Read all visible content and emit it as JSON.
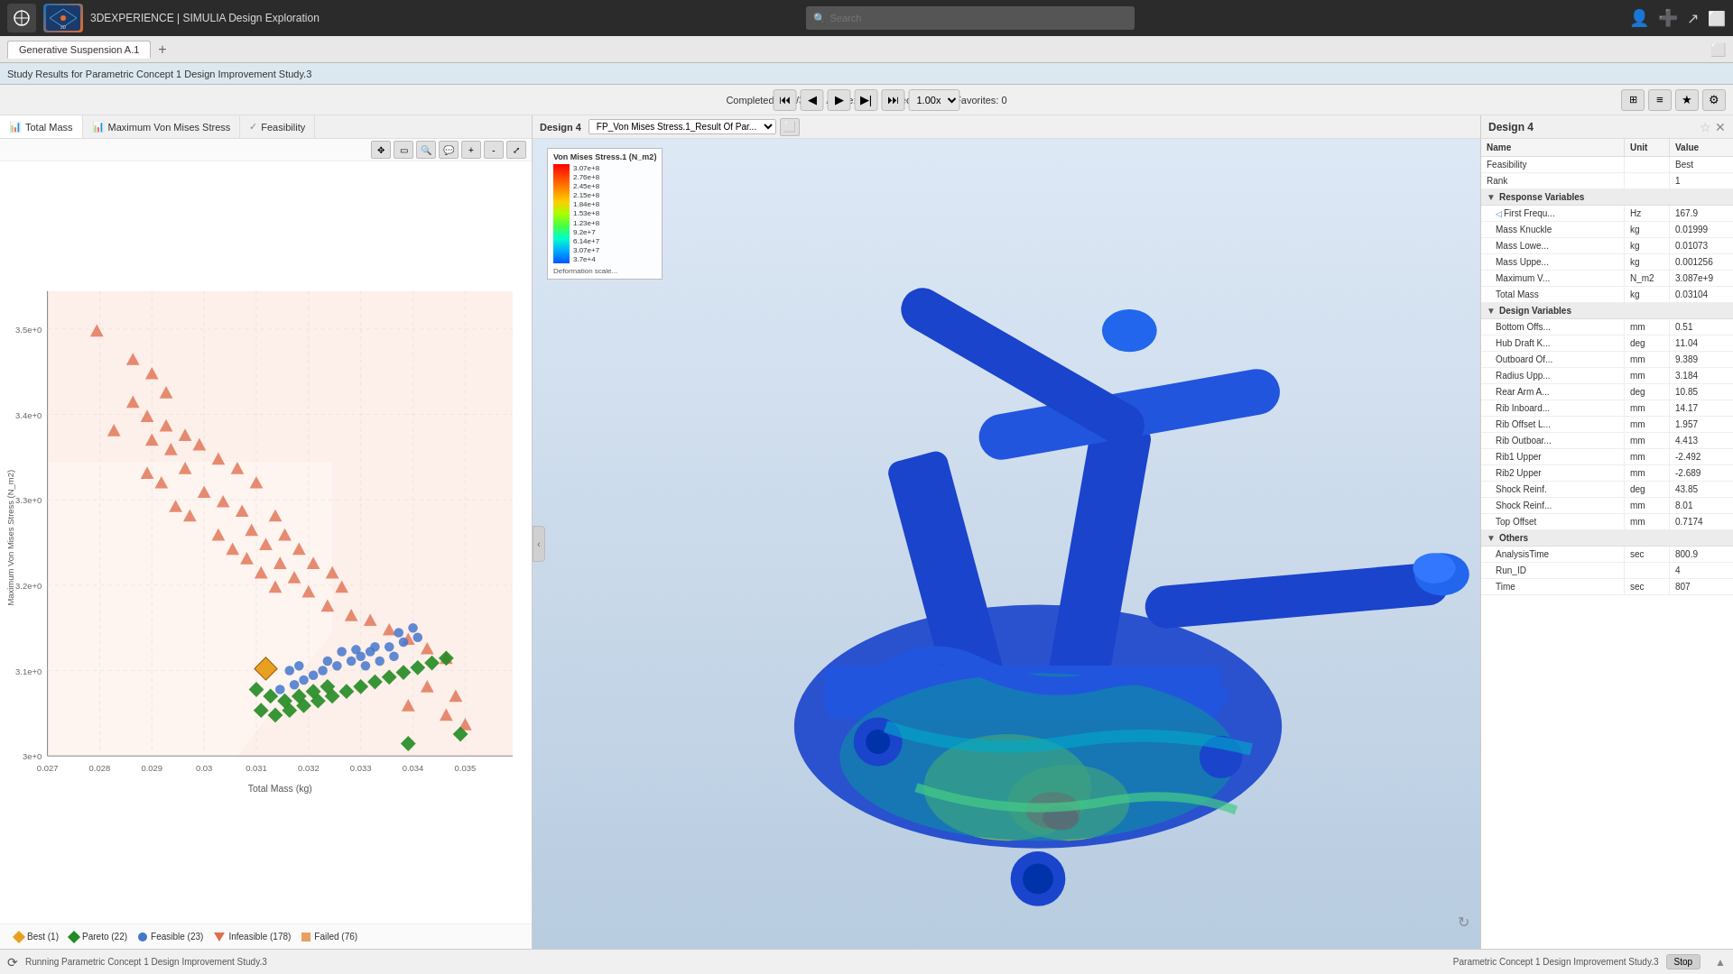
{
  "topbar": {
    "app_title": "3DEXPERIENCE | SIMULIA Design Exploration",
    "search_placeholder": "Search"
  },
  "tab": {
    "label": "Generative Suspension A.1",
    "add_label": "+"
  },
  "study_bar": {
    "label": "Study Results for Parametric Concept 1 Design Improvement Study.3"
  },
  "controls": {
    "status": "Completed: 300/300",
    "active": "Active: 300",
    "selected": "Selected: 1/1",
    "favorites": "Favorites: 0",
    "speed": "1.00x"
  },
  "plot_headers": [
    {
      "icon": "chart",
      "label": "Total Mass"
    },
    {
      "icon": "chart",
      "label": "Maximum Von Mises Stress"
    },
    {
      "icon": "check",
      "label": "Feasibility"
    }
  ],
  "scatter": {
    "x_label": "Total Mass (kg)",
    "y_label": "Maximum Von Mises Stress (N_m2)",
    "x_ticks": [
      "0.027",
      "0.028",
      "0.029",
      "0.03",
      "0.031",
      "0.032",
      "0.033",
      "0.034",
      "0.035"
    ],
    "y_ticks": [
      "3e+0",
      "3.1e+0",
      "3.2e+0",
      "3.3e+0",
      "3.4e+0",
      "3.5e+0"
    ]
  },
  "legend": {
    "items": [
      {
        "type": "diamond",
        "color": "#e8a020",
        "label": "Best (1)"
      },
      {
        "type": "diamond",
        "color": "#228B22",
        "label": "Pareto (22)"
      },
      {
        "type": "circle",
        "color": "#4477cc",
        "label": "Feasible (23)"
      },
      {
        "type": "triangle",
        "color": "#e07050",
        "label": "Infeasible (178)"
      },
      {
        "type": "square",
        "color": "#e8a060",
        "label": "Failed (76)"
      }
    ]
  },
  "color_scale": {
    "title": "Von Mises Stress.1 (N_m2)",
    "entries": [
      {
        "value": "3.07e+8",
        "color": "#ff0000"
      },
      {
        "value": "2.76e+8",
        "color": "#ff3300"
      },
      {
        "value": "2.45e+8",
        "color": "#ff6600"
      },
      {
        "value": "2.15e+8",
        "color": "#ff9900"
      },
      {
        "value": "1.84e+8",
        "color": "#ffcc00"
      },
      {
        "value": "1.53e+8",
        "color": "#ccff00"
      },
      {
        "value": "1.23e+8",
        "color": "#88ff00"
      },
      {
        "value": "9.2e+7",
        "color": "#44ff44"
      },
      {
        "value": "6.14e+7",
        "color": "#00ffaa"
      },
      {
        "value": "3.07e+7",
        "color": "#00aaff"
      },
      {
        "value": "3.7e+4",
        "color": "#0044ff"
      }
    ],
    "deformation": "Deformation scale..."
  },
  "viewer": {
    "design_label": "Design 4",
    "result_label": "FP_Von Mises Stress.1_Result Of Par..."
  },
  "right_panel": {
    "title": "Design 4",
    "col_name": "Name",
    "col_unit": "Unit",
    "col_value": "Value",
    "sections": [
      {
        "name": "top_fields",
        "rows": [
          {
            "name": "Feasibility",
            "unit": "",
            "value": "Best"
          },
          {
            "name": "Rank",
            "unit": "",
            "value": "1"
          }
        ]
      },
      {
        "name": "Response Variables",
        "rows": [
          {
            "name": "First Frequ...",
            "unit": "Hz",
            "value": "167.9"
          },
          {
            "name": "Mass Knuckle",
            "unit": "kg",
            "value": "0.01999"
          },
          {
            "name": "Mass Lowe...",
            "unit": "kg",
            "value": "0.01073"
          },
          {
            "name": "Mass Uppe...",
            "unit": "kg",
            "value": "0.001256"
          },
          {
            "name": "Maximum V...",
            "unit": "N_m2",
            "value": "3.087e+9"
          },
          {
            "name": "Total Mass",
            "unit": "kg",
            "value": "0.03104"
          }
        ]
      },
      {
        "name": "Design Variables",
        "rows": [
          {
            "name": "Bottom Offs...",
            "unit": "mm",
            "value": "0.51"
          },
          {
            "name": "Hub Draft K...",
            "unit": "deg",
            "value": "11.04"
          },
          {
            "name": "Outboard Of...",
            "unit": "mm",
            "value": "9.389"
          },
          {
            "name": "Radius Upp...",
            "unit": "mm",
            "value": "3.184"
          },
          {
            "name": "Rear Arm A...",
            "unit": "deg",
            "value": "10.85"
          },
          {
            "name": "Rib Inboard...",
            "unit": "mm",
            "value": "14.17"
          },
          {
            "name": "Rib Offset L...",
            "unit": "mm",
            "value": "1.957"
          },
          {
            "name": "Rib Outboar...",
            "unit": "mm",
            "value": "4.413"
          },
          {
            "name": "Rib1 Upper",
            "unit": "mm",
            "value": "-2.492"
          },
          {
            "name": "Rib2 Upper",
            "unit": "mm",
            "value": "-2.689"
          },
          {
            "name": "Shock Reinf.",
            "unit": "deg",
            "value": "43.85"
          },
          {
            "name": "Shock Reinf...",
            "unit": "mm",
            "value": "8.01"
          },
          {
            "name": "Top Offset",
            "unit": "mm",
            "value": "0.7174"
          }
        ]
      },
      {
        "name": "Others",
        "rows": [
          {
            "name": "AnalysisTime",
            "unit": "sec",
            "value": "800.9"
          },
          {
            "name": "Run_ID",
            "unit": "",
            "value": "4"
          },
          {
            "name": "Time",
            "unit": "sec",
            "value": "807"
          }
        ]
      }
    ]
  },
  "bottom": {
    "running_label": "Running Parametric Concept 1 Design Improvement Study.3",
    "study_label": "Parametric Concept 1 Design Improvement Study.3",
    "stop_label": "Stop"
  }
}
